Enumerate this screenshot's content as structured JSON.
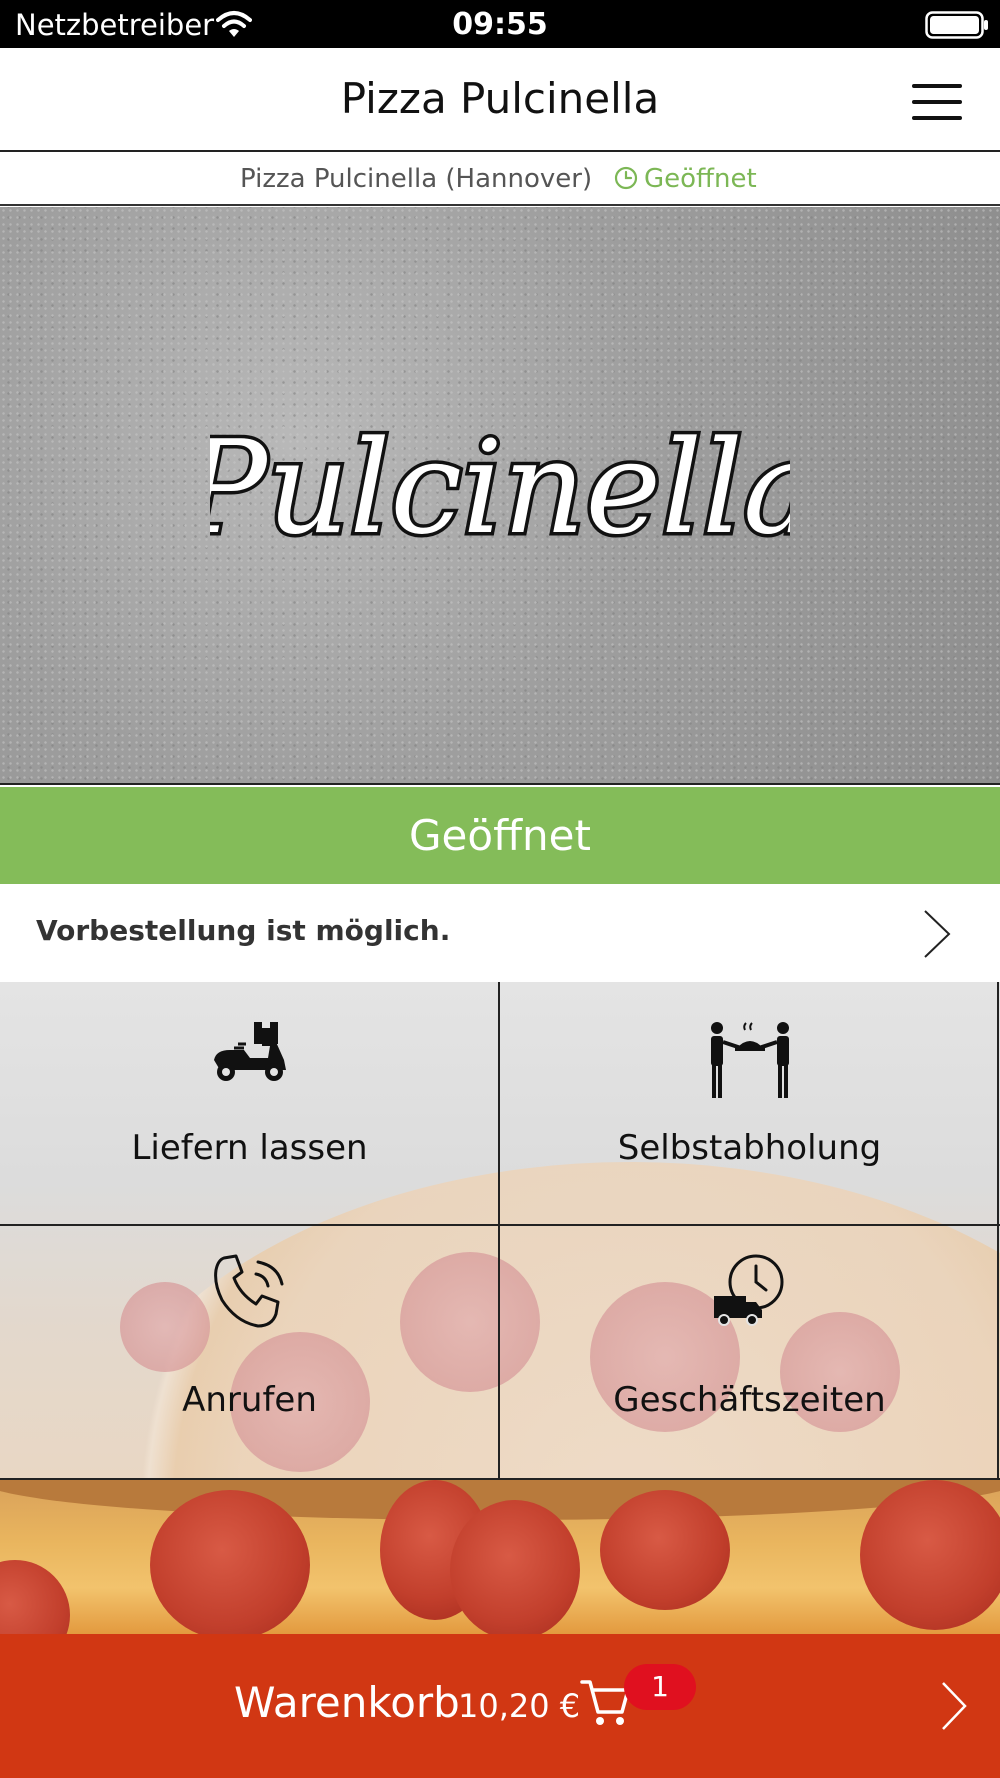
{
  "status_bar": {
    "carrier": "Netzbetreiber",
    "time": "09:55",
    "icons": [
      "wifi-icon",
      "battery-icon"
    ]
  },
  "nav": {
    "title": "Pizza Pulcinella",
    "menu_icon": "hamburger-menu-icon"
  },
  "sub_header": {
    "branch": "Pizza Pulcinella (Hannover)",
    "status": "Geöffnet",
    "status_icon": "clock-icon",
    "status_color": "#7cb755"
  },
  "hero": {
    "logo_text": "Pulcinella"
  },
  "open_banner": {
    "text": "Geöffnet",
    "color": "#84bc59"
  },
  "preorder": {
    "text": "Vorbestellung ist möglich.",
    "icon": "chevron-right-icon"
  },
  "actions": [
    {
      "label": "Liefern lassen",
      "icon": "delivery-scooter-icon"
    },
    {
      "label": "Selbstabholung",
      "icon": "pickup-handover-icon"
    },
    {
      "label": "Anrufen",
      "icon": "phone-icon"
    },
    {
      "label": "Geschäftszeiten",
      "icon": "van-clock-icon"
    }
  ],
  "cart": {
    "label": "Warenkorb",
    "amount": "10,20 €",
    "badge_count": "1",
    "icon": "cart-icon",
    "color": "#d13713",
    "badge_color": "#e0101f"
  }
}
